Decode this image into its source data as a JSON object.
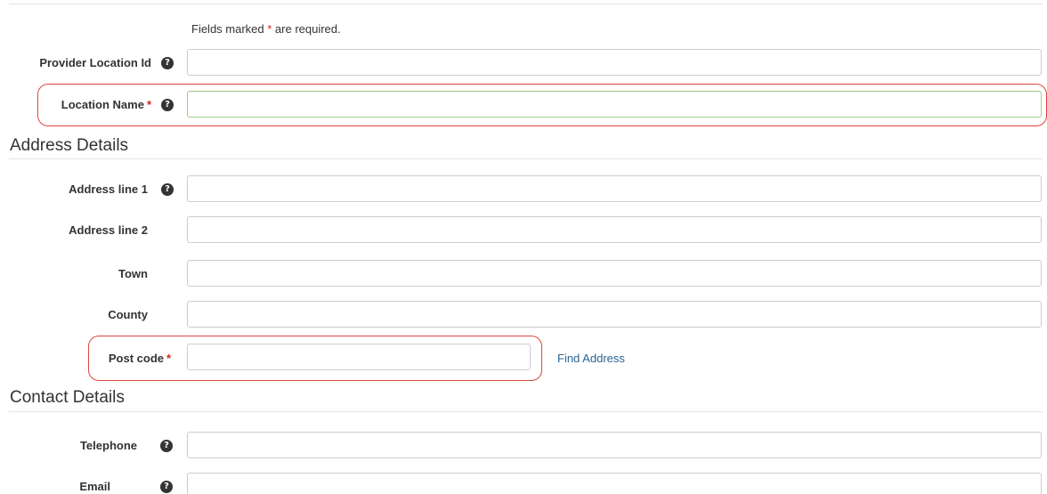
{
  "form": {
    "required_note_prefix": "Fields marked ",
    "required_note_star": "*",
    "required_note_suffix": " are required.",
    "fields": {
      "provider_location_id": {
        "label": "Provider Location Id",
        "value": ""
      },
      "location_name": {
        "label": "Location Name",
        "required_mark": "*",
        "value": ""
      }
    }
  },
  "address": {
    "title": "Address Details",
    "line1": {
      "label": "Address line 1",
      "value": ""
    },
    "line2": {
      "label": "Address line 2",
      "value": ""
    },
    "town": {
      "label": "Town",
      "value": ""
    },
    "county": {
      "label": "County",
      "value": ""
    },
    "postcode": {
      "label": "Post code",
      "required_mark": "*",
      "value": ""
    },
    "find_address_label": "Find Address"
  },
  "contact": {
    "title": "Contact Details",
    "telephone": {
      "label": "Telephone",
      "value": ""
    },
    "email": {
      "label": "Email",
      "value": ""
    }
  },
  "icons": {
    "help": "question-circle-icon"
  },
  "colors": {
    "required": "#d9231d",
    "highlight": "#e0463e",
    "link": "#2a6496"
  }
}
